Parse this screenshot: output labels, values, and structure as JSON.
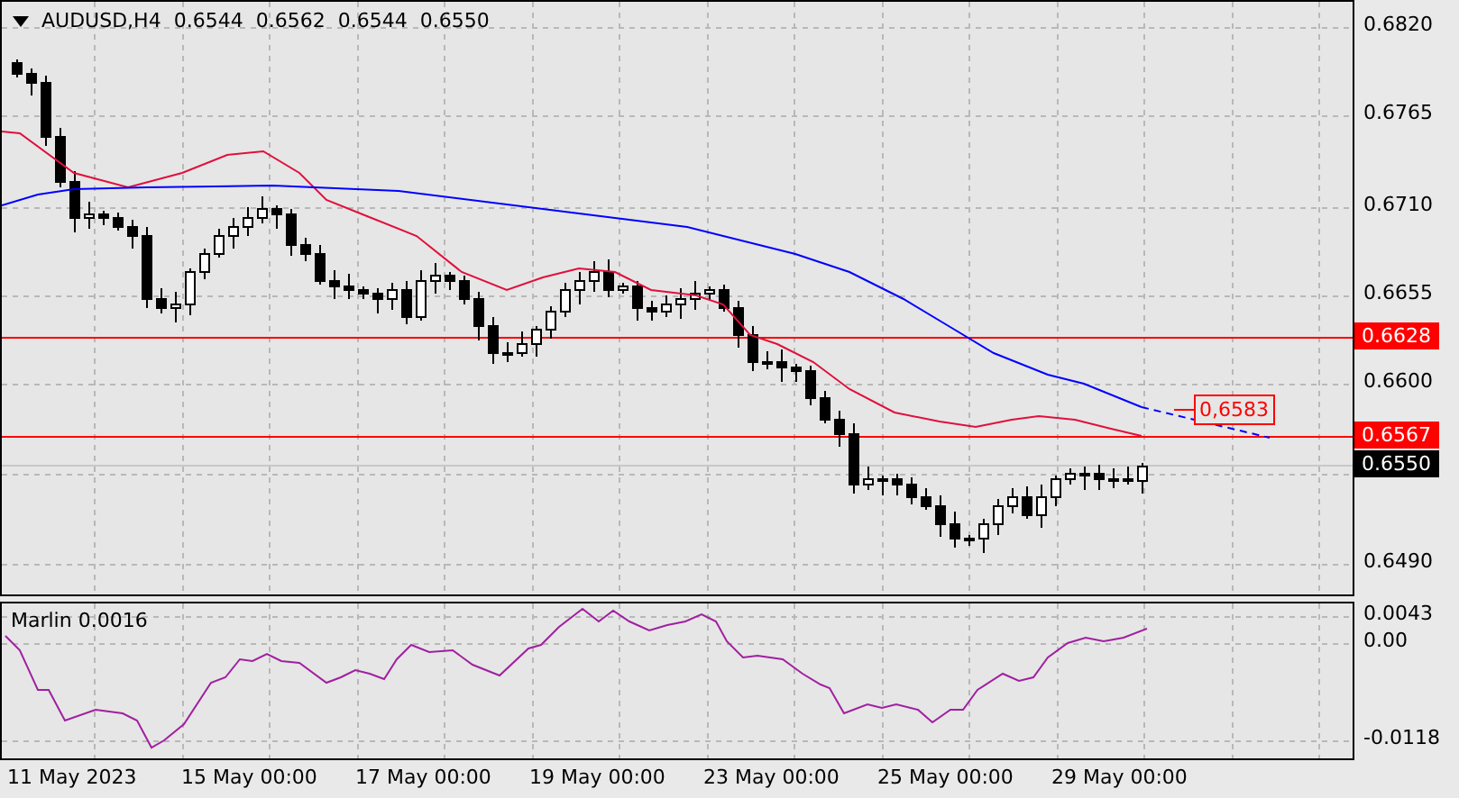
{
  "header": {
    "symbol": "AUDUSD,H4",
    "ohlc": [
      "0.6544",
      "0.6562",
      "0.6544",
      "0.6550"
    ]
  },
  "price_axis": {
    "ticks": [
      "0.6820",
      "0.6765",
      "0.6710",
      "0.6655",
      "0.6600",
      "0.6490"
    ]
  },
  "price_labels": [
    {
      "label": "0.6628",
      "kind": "level"
    },
    {
      "label": "0.6567",
      "kind": "level"
    },
    {
      "label": "0.6550",
      "kind": "current"
    }
  ],
  "projection_label": "0,6583",
  "indicator": {
    "name": "Marlin 0.0016",
    "ticks": [
      "0.0043",
      "0.00",
      "-0.0118"
    ]
  },
  "time_axis": [
    "11 May 2023",
    "15 May 00:00",
    "17 May 00:00",
    "19 May 00:00",
    "23 May 00:00",
    "25 May 00:00",
    "29 May 00:00"
  ]
}
